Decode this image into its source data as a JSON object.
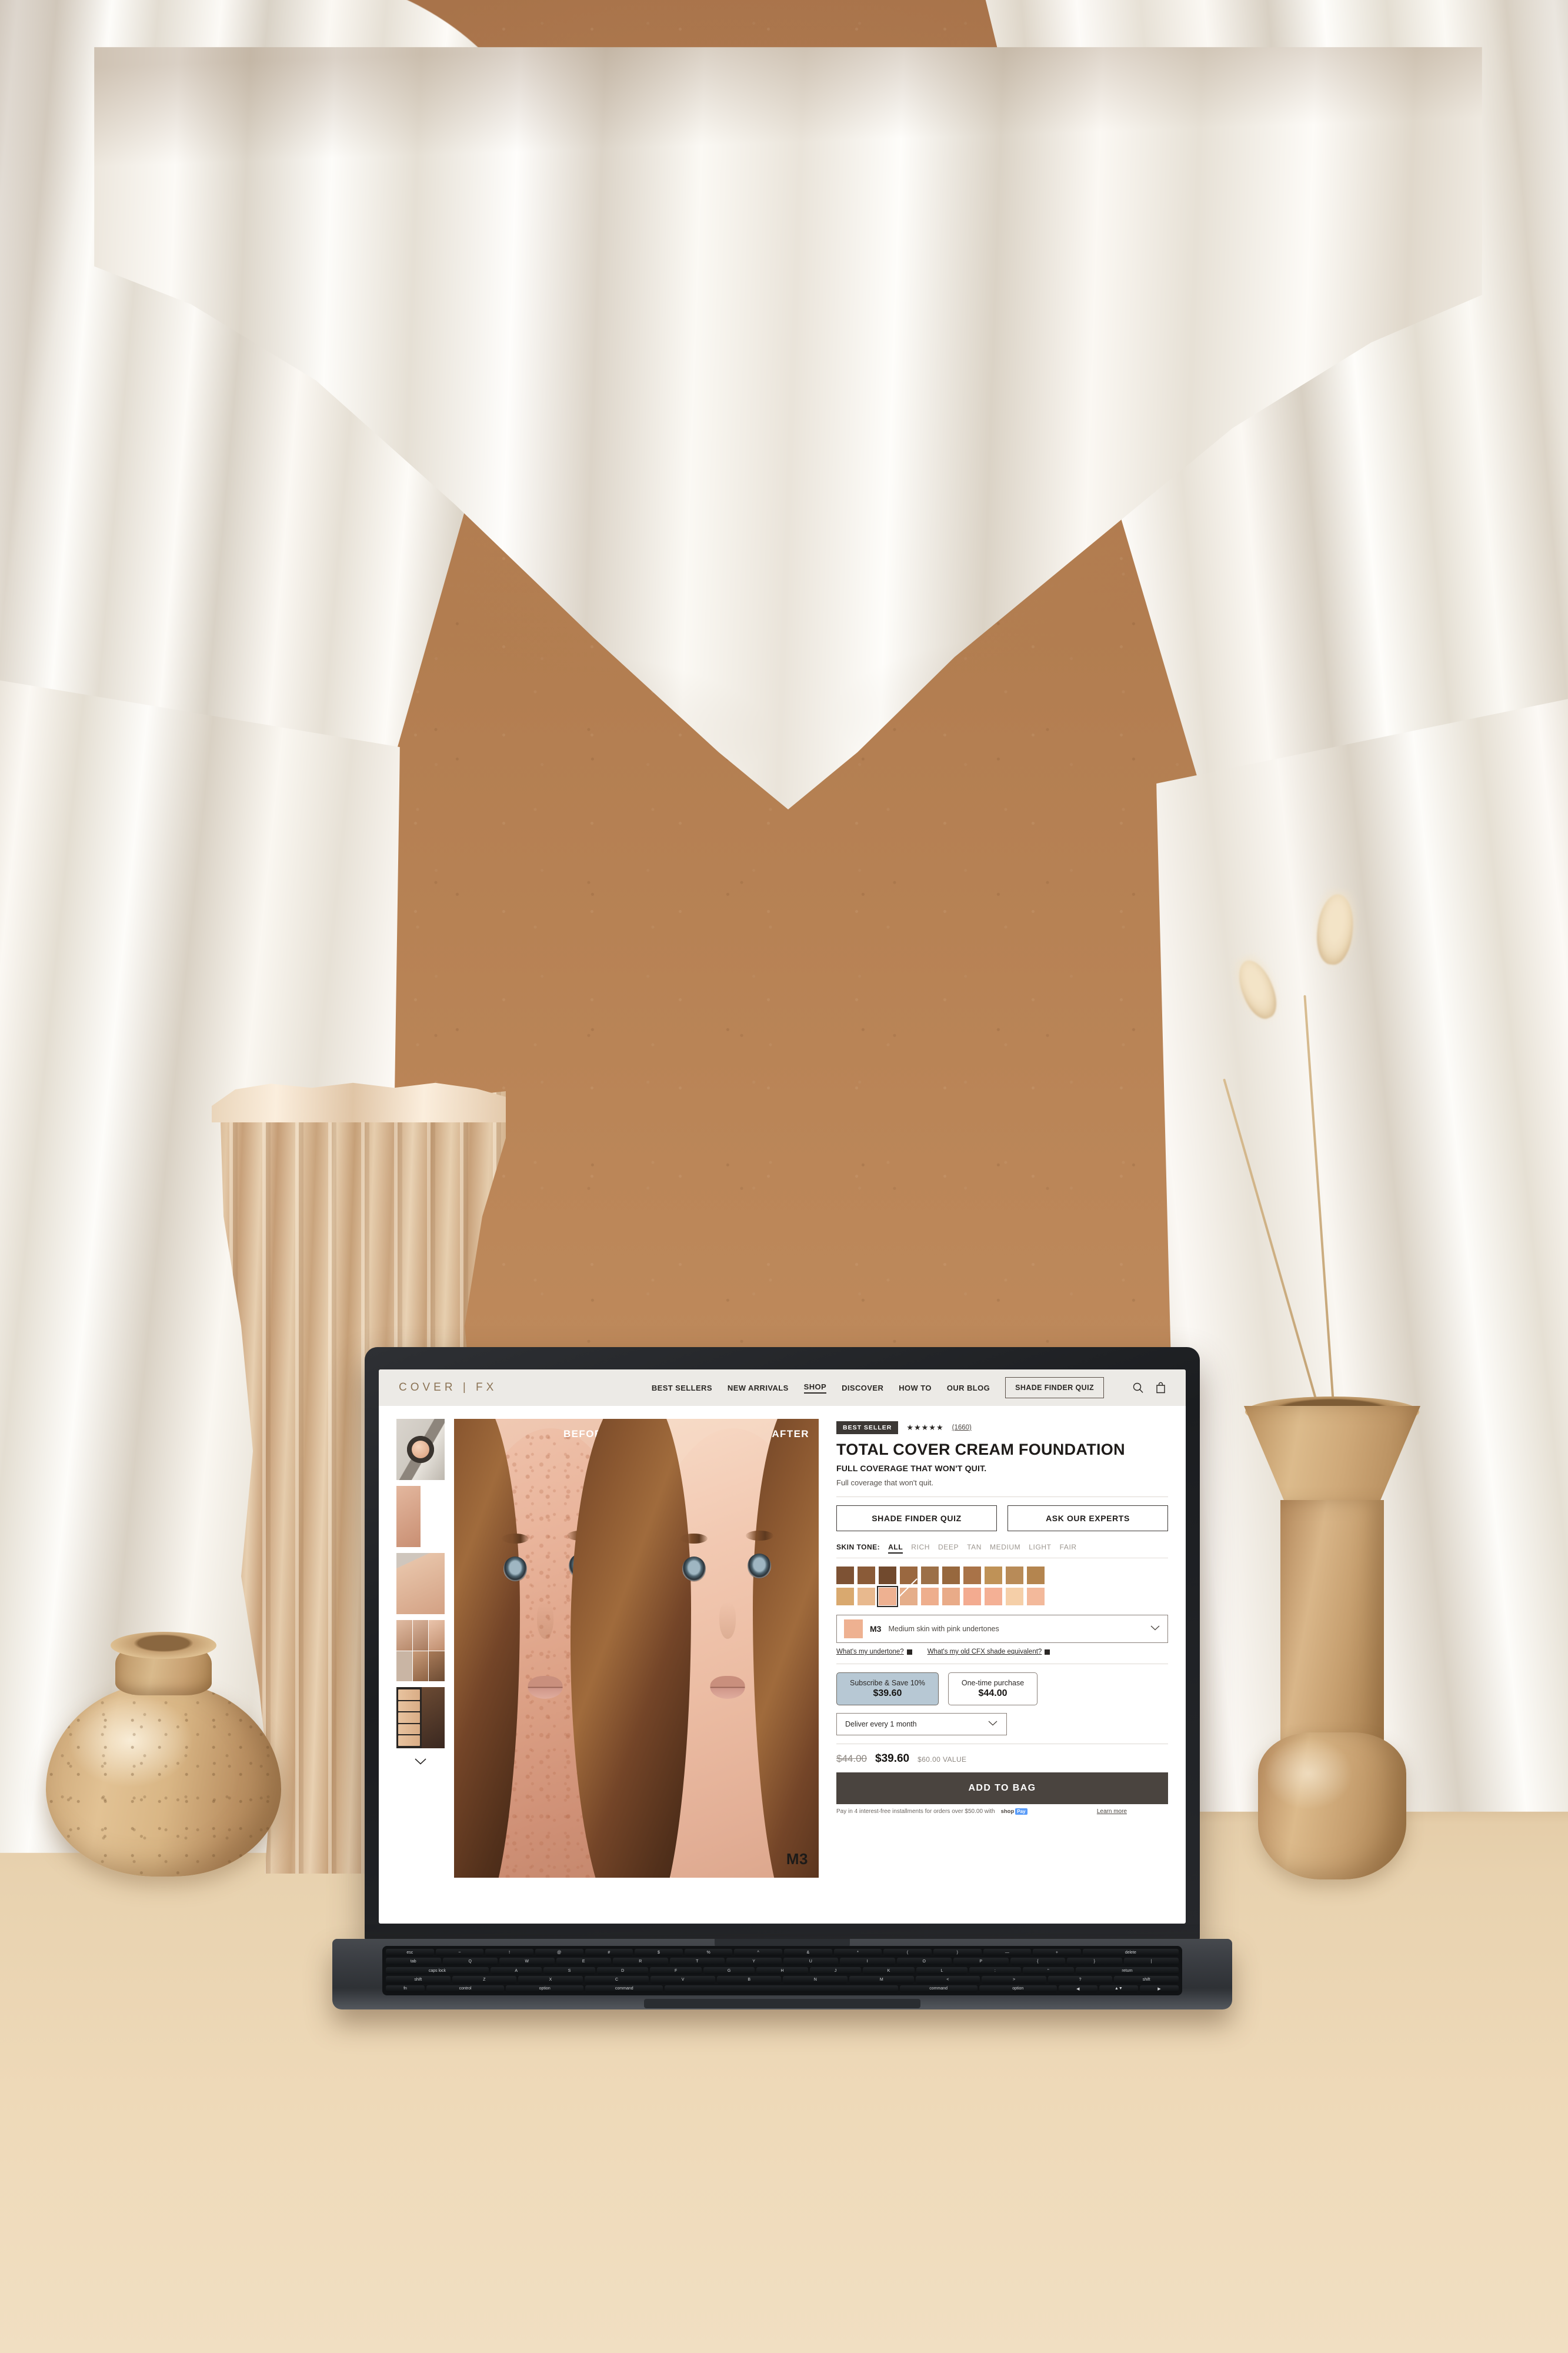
{
  "scene": {
    "description": "Laptop on a beige surface in front of white draped fabric and terracotta wall, with a wavy wooden sculpture and two ceramic vases holding dried bunny-tail grass"
  },
  "site": {
    "brand": "COVER | FX",
    "nav": {
      "links": [
        {
          "label": "BEST SELLERS",
          "active": false
        },
        {
          "label": "NEW ARRIVALS",
          "active": false
        },
        {
          "label": "SHOP",
          "active": true
        },
        {
          "label": "DISCOVER",
          "active": false
        },
        {
          "label": "HOW TO",
          "active": false
        },
        {
          "label": "OUR BLOG",
          "active": false
        }
      ],
      "quiz_button": "SHADE FINDER QUIZ",
      "icons": [
        "search-icon",
        "shopping-bag-icon"
      ]
    },
    "gallery": {
      "before_label": "BEFORE",
      "after_label": "AFTER",
      "hero_shade_label": "M3",
      "thumb_count": 5,
      "more_chevron": "chevron-down-icon"
    },
    "product": {
      "badge": "BEST SELLER",
      "stars": "★★★★★",
      "review_count": "(1660)",
      "title": "TOTAL COVER CREAM FOUNDATION",
      "subtitle": "FULL COVERAGE THAT WON'T QUIT.",
      "description": "Full coverage that won't quit.",
      "buttons": [
        "SHADE FINDER QUIZ",
        "ASK OUR EXPERTS"
      ],
      "skin_tone_label": "SKIN TONE:",
      "skin_tones": [
        {
          "label": "ALL",
          "selected": true
        },
        {
          "label": "RICH",
          "selected": false
        },
        {
          "label": "DEEP",
          "selected": false
        },
        {
          "label": "TAN",
          "selected": false
        },
        {
          "label": "MEDIUM",
          "selected": false
        },
        {
          "label": "LIGHT",
          "selected": false
        },
        {
          "label": "FAIR",
          "selected": false
        }
      ],
      "swatch_rows": [
        [
          {
            "color": "#7d5234",
            "selected": false,
            "out_of_stock": false
          },
          {
            "color": "#8a5b38",
            "selected": false,
            "out_of_stock": false
          },
          {
            "color": "#714a2e",
            "selected": false,
            "out_of_stock": false
          },
          {
            "color": "#9a6840",
            "selected": false,
            "out_of_stock": false
          },
          {
            "color": "#9c7048",
            "selected": false,
            "out_of_stock": false
          },
          {
            "color": "#97683e",
            "selected": false,
            "out_of_stock": false
          },
          {
            "color": "#a97348",
            "selected": false,
            "out_of_stock": false
          },
          {
            "color": "#bf9257",
            "selected": false,
            "out_of_stock": false
          },
          {
            "color": "#b88b58",
            "selected": false,
            "out_of_stock": false
          },
          {
            "color": "#b4854f",
            "selected": false,
            "out_of_stock": false
          }
        ],
        [
          {
            "color": "#d9a96f",
            "selected": false,
            "out_of_stock": false
          },
          {
            "color": "#e8b98e",
            "selected": false,
            "out_of_stock": false
          },
          {
            "color": "#eeb191",
            "selected": true,
            "out_of_stock": false
          },
          {
            "color": "#e5ae8a",
            "selected": false,
            "out_of_stock": true
          },
          {
            "color": "#eeae8d",
            "selected": false,
            "out_of_stock": false
          },
          {
            "color": "#e9ab88",
            "selected": false,
            "out_of_stock": false
          },
          {
            "color": "#f3ab90",
            "selected": false,
            "out_of_stock": false
          },
          {
            "color": "#f4b095",
            "selected": false,
            "out_of_stock": false
          },
          {
            "color": "#f5cfa8",
            "selected": false,
            "out_of_stock": false
          },
          {
            "color": "#f3b99b",
            "selected": false,
            "out_of_stock": false
          }
        ]
      ],
      "selected_shade": {
        "code": "M3",
        "description": "Medium skin with pink undertones",
        "swatch_color": "#eeb191"
      },
      "help_links": [
        "What's my undertone?",
        "What's my old CFX shade equivalent?"
      ],
      "purchase_options": [
        {
          "label": "Subscribe & Save 10%",
          "price": "$39.60",
          "selected": true
        },
        {
          "label": "One-time purchase",
          "price": "$44.00",
          "selected": false
        }
      ],
      "delivery_frequency": "Deliver every 1 month",
      "price": {
        "original": "$44.00",
        "current": "$39.60",
        "value_note": "$60.00 VALUE"
      },
      "add_to_bag": "ADD TO BAG",
      "installments": "Pay in 4 interest-free installments for orders over $50.00 with",
      "shop_pay": "shop",
      "shop_pay_pill": "Pay",
      "learn_more": "Learn more"
    },
    "colors": {
      "nav_background": "#eceae6",
      "brand_gold": "#8b7355",
      "text_dark": "#1e1b19",
      "badge_dark": "#3c3835",
      "subscribe_blue": "#b7c8d4",
      "add_to_bag": "#4a443f"
    }
  },
  "keyboard": {
    "rows": [
      [
        "esc",
        "~",
        "!",
        "@",
        "#",
        "$",
        "%",
        "^",
        "&",
        "*",
        "(",
        ")",
        "—",
        "+",
        "delete"
      ],
      [
        "tab",
        "Q",
        "W",
        "E",
        "R",
        "T",
        "Y",
        "U",
        "I",
        "O",
        "P",
        "{",
        "}",
        "|"
      ],
      [
        "caps lock",
        "A",
        "S",
        "D",
        "F",
        "G",
        "H",
        "J",
        "K",
        "L",
        ":",
        "\"",
        "return"
      ],
      [
        "shift",
        "Z",
        "X",
        "C",
        "V",
        "B",
        "N",
        "M",
        "<",
        ">",
        "?",
        "shift"
      ],
      [
        "fn",
        "control",
        "option",
        "command",
        "",
        "command",
        "option",
        "◀",
        "▲▼",
        "▶"
      ]
    ]
  }
}
